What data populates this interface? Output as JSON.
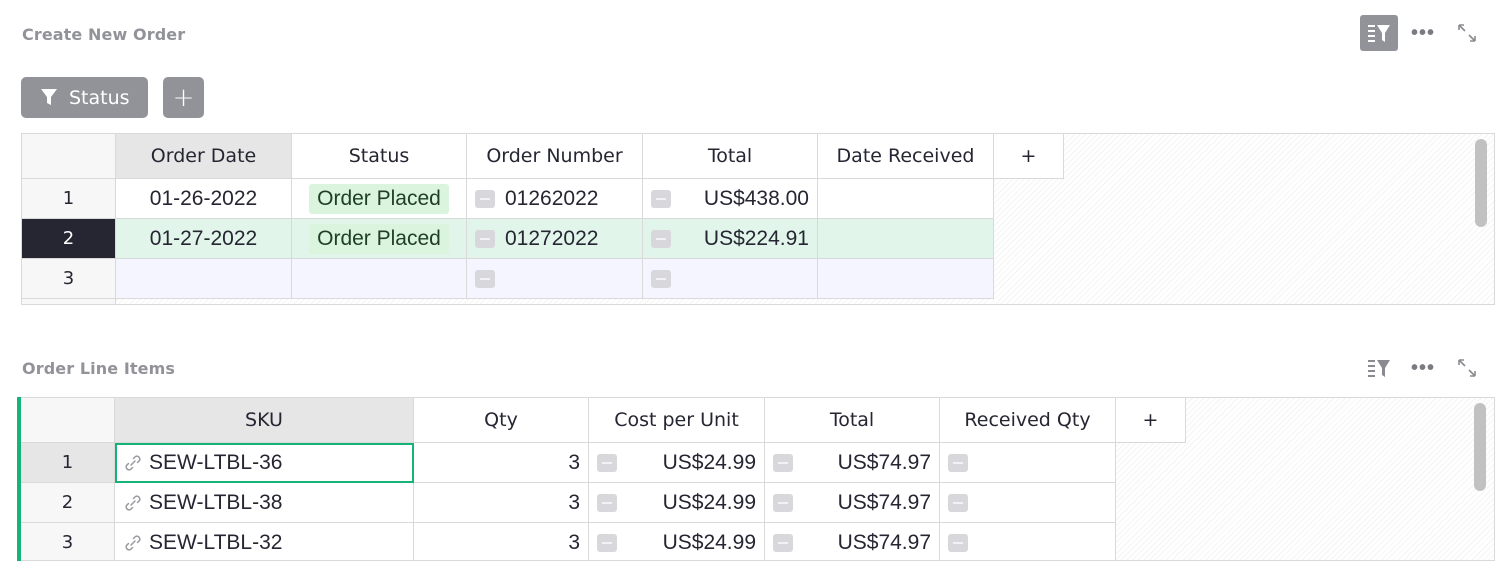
{
  "orders_section": {
    "title": "Create New Order",
    "icons": [
      "sort-filter-icon",
      "more-icon",
      "expand-icon"
    ],
    "more_label": "•••"
  },
  "filter_bar": {
    "status_filter_label": "Status",
    "add_filter_label": "+"
  },
  "orders_table": {
    "columns": [
      "Order Date",
      "Status",
      "Order Number",
      "Total",
      "Date Received",
      "+"
    ],
    "rows": [
      {
        "num": "1",
        "order_date": "01-26-2022",
        "status": "Order Placed",
        "order_number": "01262022",
        "total": "US$438.00",
        "date_received": ""
      },
      {
        "num": "2",
        "order_date": "01-27-2022",
        "status": "Order Placed",
        "order_number": "01272022",
        "total": "US$224.91",
        "date_received": ""
      },
      {
        "num": "3",
        "order_date": "",
        "status": "",
        "order_number": "",
        "total": "",
        "date_received": ""
      }
    ]
  },
  "line_items_section": {
    "title": "Order Line Items",
    "icons": [
      "sort-filter-icon",
      "more-icon",
      "expand-icon"
    ],
    "more_label": "•••"
  },
  "line_items_table": {
    "columns": [
      "SKU",
      "Qty",
      "Cost per Unit",
      "Total",
      "Received Qty",
      "+"
    ],
    "rows": [
      {
        "num": "1",
        "sku": "SEW-LTBL-36",
        "qty": "3",
        "cost": "US$24.99",
        "total": "US$74.97",
        "received_qty": ""
      },
      {
        "num": "2",
        "sku": "SEW-LTBL-38",
        "qty": "3",
        "cost": "US$24.99",
        "total": "US$74.97",
        "received_qty": ""
      },
      {
        "num": "3",
        "sku": "SEW-LTBL-32",
        "qty": "3",
        "cost": "US$24.99",
        "total": "US$74.97",
        "received_qty": ""
      }
    ]
  },
  "colors": {
    "accent_green": "#16b378",
    "chip_bg": "#daf4dd",
    "selected_row_bg": "#e1f5ea",
    "active_row_number_bg": "#262633",
    "filter_pill_bg": "#929299"
  }
}
